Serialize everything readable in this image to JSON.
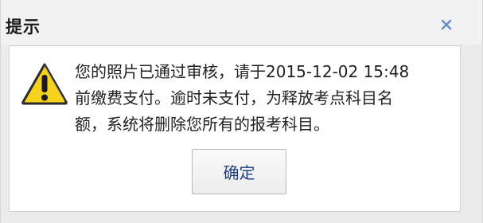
{
  "dialog": {
    "title": "提示",
    "close_label": "×",
    "message": "您的照片已通过审核，请于2015-12-02 15:48\n前缴费支付。逾时未支付，为释放考点科目名\n额，系统将删除您所有的报考科目。",
    "ok_label": "确定",
    "icon": "warning-triangle-icon",
    "colors": {
      "close_x": "#6a8fc8",
      "warning_fill": "#f5d21b",
      "warning_border": "#2b2b2b",
      "ok_text": "#1f3d7a"
    }
  }
}
